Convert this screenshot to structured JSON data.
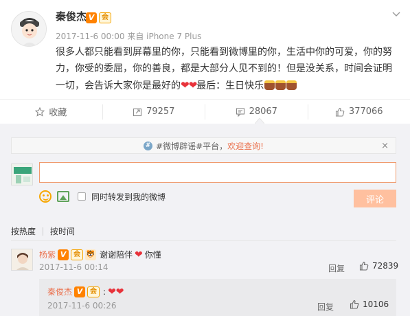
{
  "post": {
    "author": "秦俊杰",
    "meta": "2017-11-6 00:00 来自 iPhone 7 Plus",
    "text_main": "很多人都只能看到屏幕里的你，只能看到微博里的你，生活中你的可爱，你的努力，你受的委屈，你的善良，都是大部分人见不到的！但是没关系，时间会证明一切，会告诉大家你是最好的",
    "text_hearts": "❤❤",
    "text_tail": "最后：生日快乐",
    "badge_v": "V",
    "badge_vip": "会"
  },
  "actions": {
    "favorite_label": "收藏",
    "repost_count": "79257",
    "comment_count": "28067",
    "like_count": "377066"
  },
  "comment_box": {
    "notice_tag": "#微博辟谣#平台，",
    "notice_link": "欢迎查询!",
    "notice_close": "×",
    "input_value": "",
    "also_repost_label": "同时转发到我的微博",
    "submit_label": "评论"
  },
  "sort": {
    "hot_label": "按热度",
    "time_label": "按时间"
  },
  "comments": [
    {
      "name": "杨紫",
      "text_before": "谢谢陪伴",
      "hearts": "❤",
      "text_after": "你懂",
      "time": "2017-11-6 00:14",
      "reply_label": "回复",
      "likes": "72839",
      "reply": {
        "name": "秦俊杰",
        "hearts": "❤❤",
        "time": "2017-11-6 00:26",
        "reply_label": "回复",
        "likes": "10106"
      }
    }
  ],
  "colors": {
    "accent_orange": "#eb7350",
    "button_disabled": "#ffc09f",
    "heart_red": "#e8323a"
  }
}
